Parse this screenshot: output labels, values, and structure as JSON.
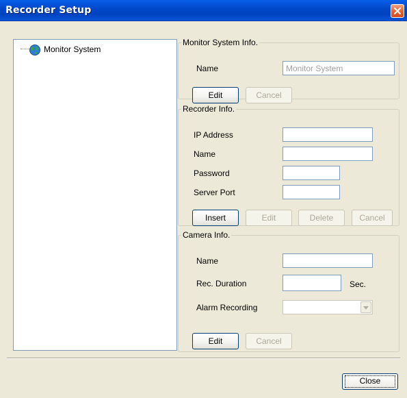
{
  "window": {
    "title": "Recorder Setup"
  },
  "tree": {
    "items": [
      {
        "label": "Monitor System"
      }
    ]
  },
  "monitor_info": {
    "legend": "Monitor System Info.",
    "name_label": "Name",
    "name_value": "Monitor System",
    "edit_label": "Edit",
    "cancel_label": "Cancel"
  },
  "recorder_info": {
    "legend": "Recorder Info.",
    "ip_label": "IP Address",
    "ip_value": "",
    "name_label": "Name",
    "name_value": "",
    "password_label": "Password",
    "password_value": "",
    "port_label": "Server Port",
    "port_value": "",
    "insert_label": "Insert",
    "edit_label": "Edit",
    "delete_label": "Delete",
    "cancel_label": "Cancel"
  },
  "camera_info": {
    "legend": "Camera Info.",
    "name_label": "Name",
    "name_value": "",
    "duration_label": "Rec. Duration",
    "duration_value": "",
    "duration_unit": "Sec.",
    "alarm_label": "Alarm Recording",
    "alarm_value": "",
    "edit_label": "Edit",
    "cancel_label": "Cancel"
  },
  "footer": {
    "close_label": "Close"
  },
  "icons": {
    "close": "close-icon",
    "tree": "globe-icon",
    "dropdown": "chevron-down-icon"
  },
  "colors": {
    "titlebar": "#0046c7",
    "close_button": "#e3602f",
    "dialog_bg": "#ece9d8"
  }
}
